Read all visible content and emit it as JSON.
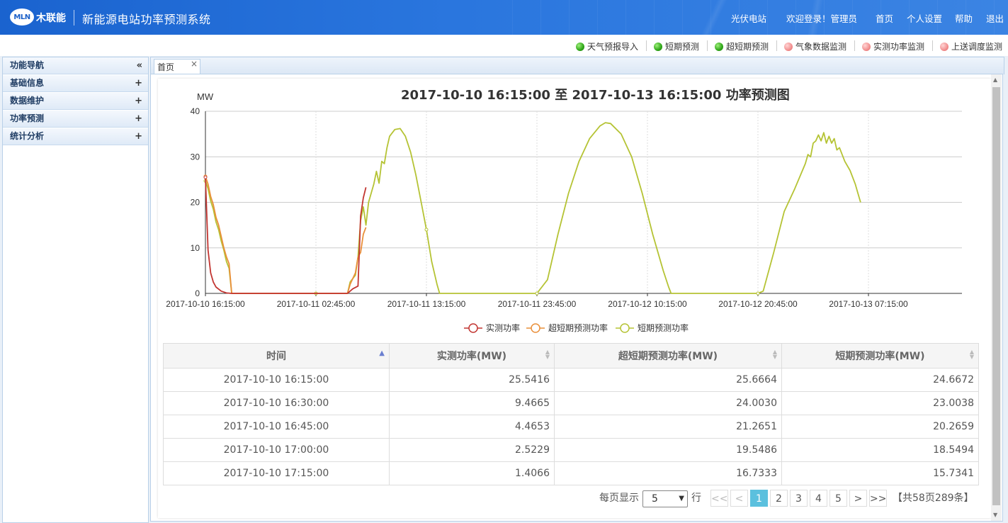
{
  "header": {
    "logo_mark": "MLN",
    "logo_name": "木联能",
    "system_title": "新能源电站功率预测系统",
    "station": "光伏电站",
    "welcome": "欢迎登录！管理员",
    "home": "首页",
    "settings": "个人设置",
    "help": "帮助",
    "logout": "退出"
  },
  "quick_links": [
    {
      "label": "天气预报导入",
      "status": "green"
    },
    {
      "label": "短期预测",
      "status": "green"
    },
    {
      "label": "超短期预测",
      "status": "green"
    },
    {
      "label": "气象数据监测",
      "status": "pink"
    },
    {
      "label": "实测功率监测",
      "status": "pink"
    },
    {
      "label": "上送调度监测",
      "status": "pink"
    }
  ],
  "sidebar": {
    "title": "功能导航",
    "collapse_icon": "«",
    "items": [
      {
        "label": "基础信息"
      },
      {
        "label": "数据维护"
      },
      {
        "label": "功率预测"
      },
      {
        "label": "统计分析"
      }
    ]
  },
  "tabs": [
    {
      "label": "首页"
    }
  ],
  "chart_data": {
    "type": "line",
    "title": "2017-10-10 16:15:00 至 2017-10-13 16:15:00 功率预测图",
    "ylabel": "MW",
    "ylim": [
      0,
      40
    ],
    "yticks": [
      0,
      10,
      20,
      30,
      40
    ],
    "xticks": [
      "2017-10-10 16:15:00",
      "2017-10-11 02:45:00",
      "2017-10-11 13:15:00",
      "2017-10-11 23:45:00",
      "2017-10-12 10:15:00",
      "2017-10-12 20:45:00",
      "2017-10-13 07:15:00"
    ],
    "x_hours_per_tick": 10.5,
    "grid": true,
    "legend_position": "bottom",
    "series": [
      {
        "name": "实测功率",
        "color": "#c23531",
        "points": [
          [
            0,
            25.5
          ],
          [
            0.25,
            9.5
          ],
          [
            0.5,
            4.5
          ],
          [
            0.75,
            2.5
          ],
          [
            1,
            1.4
          ],
          [
            1.5,
            0.5
          ],
          [
            2,
            0.1
          ],
          [
            2.5,
            0
          ],
          [
            13.5,
            0
          ],
          [
            14,
            1.0
          ],
          [
            14.5,
            1.6
          ],
          [
            14.75,
            17
          ],
          [
            15,
            21
          ],
          [
            15.25,
            23.3
          ]
        ]
      },
      {
        "name": "超短期预测功率",
        "color": "#e98f3a",
        "points": [
          [
            0,
            25.7
          ],
          [
            0.25,
            24.0
          ],
          [
            0.5,
            21.3
          ],
          [
            0.75,
            19.5
          ],
          [
            1,
            16.7
          ],
          [
            1.25,
            15
          ],
          [
            1.5,
            12.5
          ],
          [
            1.75,
            10
          ],
          [
            2,
            8
          ],
          [
            2.25,
            6.5
          ],
          [
            2.5,
            0
          ],
          [
            13.5,
            0
          ],
          [
            13.75,
            2
          ],
          [
            14.25,
            4.5
          ],
          [
            14.5,
            8
          ],
          [
            14.75,
            9
          ],
          [
            15,
            13
          ],
          [
            15.25,
            14.5
          ]
        ]
      },
      {
        "name": "短期预测功率",
        "color": "#b5c334",
        "points": [
          [
            0,
            24.7
          ],
          [
            0.25,
            23.0
          ],
          [
            0.5,
            20.3
          ],
          [
            0.75,
            18.5
          ],
          [
            1,
            15.7
          ],
          [
            1.25,
            14
          ],
          [
            1.5,
            11.5
          ],
          [
            1.75,
            9.5
          ],
          [
            2,
            7
          ],
          [
            2.25,
            5.5
          ],
          [
            2.5,
            0
          ],
          [
            10.5,
            0
          ],
          [
            13.5,
            0
          ],
          [
            13.75,
            2.5
          ],
          [
            14.25,
            4
          ],
          [
            14.5,
            8
          ],
          [
            14.75,
            16
          ],
          [
            15,
            19
          ],
          [
            15.25,
            15
          ],
          [
            15.5,
            20
          ],
          [
            15.75,
            22
          ],
          [
            16,
            24
          ],
          [
            16.25,
            26.8
          ],
          [
            16.5,
            24.2
          ],
          [
            16.75,
            29
          ],
          [
            17,
            28.5
          ],
          [
            17.25,
            32
          ],
          [
            17.5,
            34.5
          ],
          [
            18,
            36
          ],
          [
            18.5,
            36.2
          ],
          [
            19,
            34.5
          ],
          [
            19.5,
            31
          ],
          [
            20,
            26
          ],
          [
            20.5,
            20
          ],
          [
            21,
            14
          ],
          [
            21.5,
            7
          ],
          [
            22,
            2
          ],
          [
            22.25,
            0
          ],
          [
            31.5,
            0
          ],
          [
            32.5,
            3
          ],
          [
            33.5,
            13
          ],
          [
            34.5,
            22
          ],
          [
            35.5,
            29
          ],
          [
            36.5,
            34
          ],
          [
            37.5,
            36.8
          ],
          [
            38,
            37.5
          ],
          [
            38.5,
            37.3
          ],
          [
            39.5,
            35
          ],
          [
            40.5,
            30
          ],
          [
            41.5,
            22
          ],
          [
            42.5,
            13
          ],
          [
            43.5,
            5
          ],
          [
            44,
            1.5
          ],
          [
            44.25,
            0
          ],
          [
            52.5,
            0
          ],
          [
            53,
            0.5
          ],
          [
            54,
            9
          ],
          [
            55,
            18
          ],
          [
            56,
            23
          ],
          [
            57,
            28.5
          ],
          [
            57.25,
            30.5
          ],
          [
            57.5,
            30
          ],
          [
            57.75,
            33
          ],
          [
            58,
            33.5
          ],
          [
            58.25,
            34.8
          ],
          [
            58.5,
            33.5
          ],
          [
            58.75,
            35.3
          ],
          [
            59,
            33
          ],
          [
            59.25,
            34.5
          ],
          [
            59.5,
            33
          ],
          [
            59.75,
            34
          ],
          [
            60,
            31.5
          ],
          [
            60.25,
            32
          ],
          [
            60.75,
            29
          ],
          [
            61.25,
            27
          ],
          [
            61.75,
            24
          ],
          [
            62,
            22
          ],
          [
            62.25,
            20
          ]
        ]
      }
    ]
  },
  "table": {
    "columns": [
      "时间",
      "实测功率(MW)",
      "超短期预测功率(MW)",
      "短期预测功率(MW)"
    ],
    "rows": [
      [
        "2017-10-10 16:15:00",
        "25.5416",
        "25.6664",
        "24.6672"
      ],
      [
        "2017-10-10 16:30:00",
        "9.4665",
        "24.0030",
        "23.0038"
      ],
      [
        "2017-10-10 16:45:00",
        "4.4653",
        "21.2651",
        "20.2659"
      ],
      [
        "2017-10-10 17:00:00",
        "2.5229",
        "19.5486",
        "18.5494"
      ],
      [
        "2017-10-10 17:15:00",
        "1.4066",
        "16.7333",
        "15.7341"
      ]
    ]
  },
  "pager": {
    "per_page_label": "每页显示",
    "per_page_value": "5",
    "row_unit": "行",
    "first": "<<",
    "prev": "<",
    "pages": [
      "1",
      "2",
      "3",
      "4",
      "5"
    ],
    "current_page": "1",
    "next": ">",
    "last": ">>",
    "summary": "【共58页289条】"
  }
}
